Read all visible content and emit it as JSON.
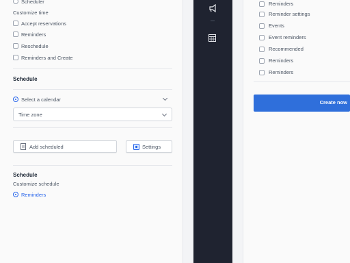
{
  "left": {
    "top_item": "Scheduler",
    "subtitle": "Customize time",
    "options": [
      "Accept reservations",
      "Reminders",
      "Reschedule",
      "Reminders and Create"
    ],
    "section1": "Schedule",
    "select1": "Select a calendar",
    "select2": "Time zone",
    "btn_add": "Add scheduled",
    "btn_settings": "Settings",
    "section2": "Schedule",
    "section2_sub": "Customize schedule",
    "link": "Reminders"
  },
  "right": {
    "items": [
      "Reminders",
      "Reminder settings",
      "Events",
      "Event reminders",
      "Recommended",
      "Reminders",
      "Reminders"
    ],
    "primary_button": "Create now"
  },
  "colors": {
    "accent": "#2f6fdb",
    "dark_bar": "#1f2330"
  }
}
